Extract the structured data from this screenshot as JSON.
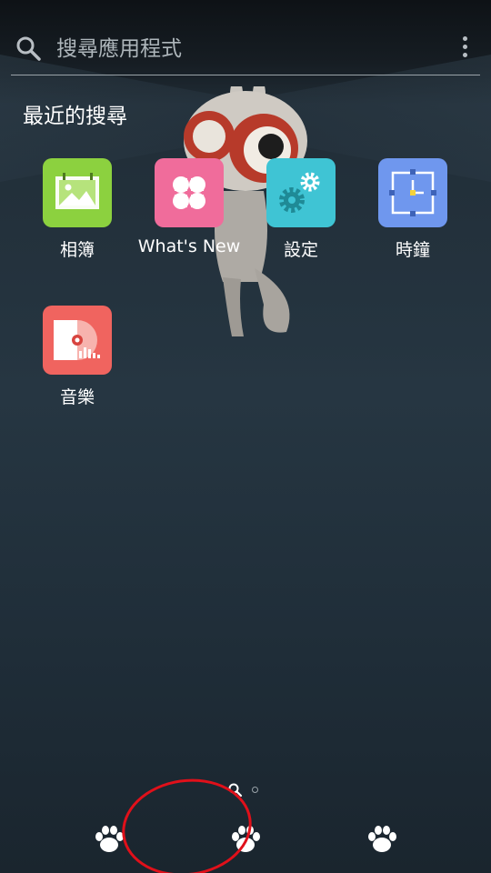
{
  "search": {
    "placeholder": "搜尋應用程式"
  },
  "recent": {
    "title": "最近的搜尋"
  },
  "apps": [
    {
      "label": "相簿",
      "icon": "gallery-icon",
      "color": "#8cd13f"
    },
    {
      "label": "What's New",
      "icon": "whats-new-icon",
      "color": "#f06c9b"
    },
    {
      "label": "設定",
      "icon": "settings-icon",
      "color": "#3fc4d4"
    },
    {
      "label": "時鐘",
      "icon": "clock-icon",
      "color": "#6f97ee"
    },
    {
      "label": "音樂",
      "icon": "music-icon",
      "color": "#f0645f"
    }
  ],
  "dock": {
    "items": [
      "paw-icon",
      "paw-icon",
      "paw-icon"
    ]
  },
  "colors": {
    "annotation": "#e0101a",
    "background": "#243440"
  }
}
